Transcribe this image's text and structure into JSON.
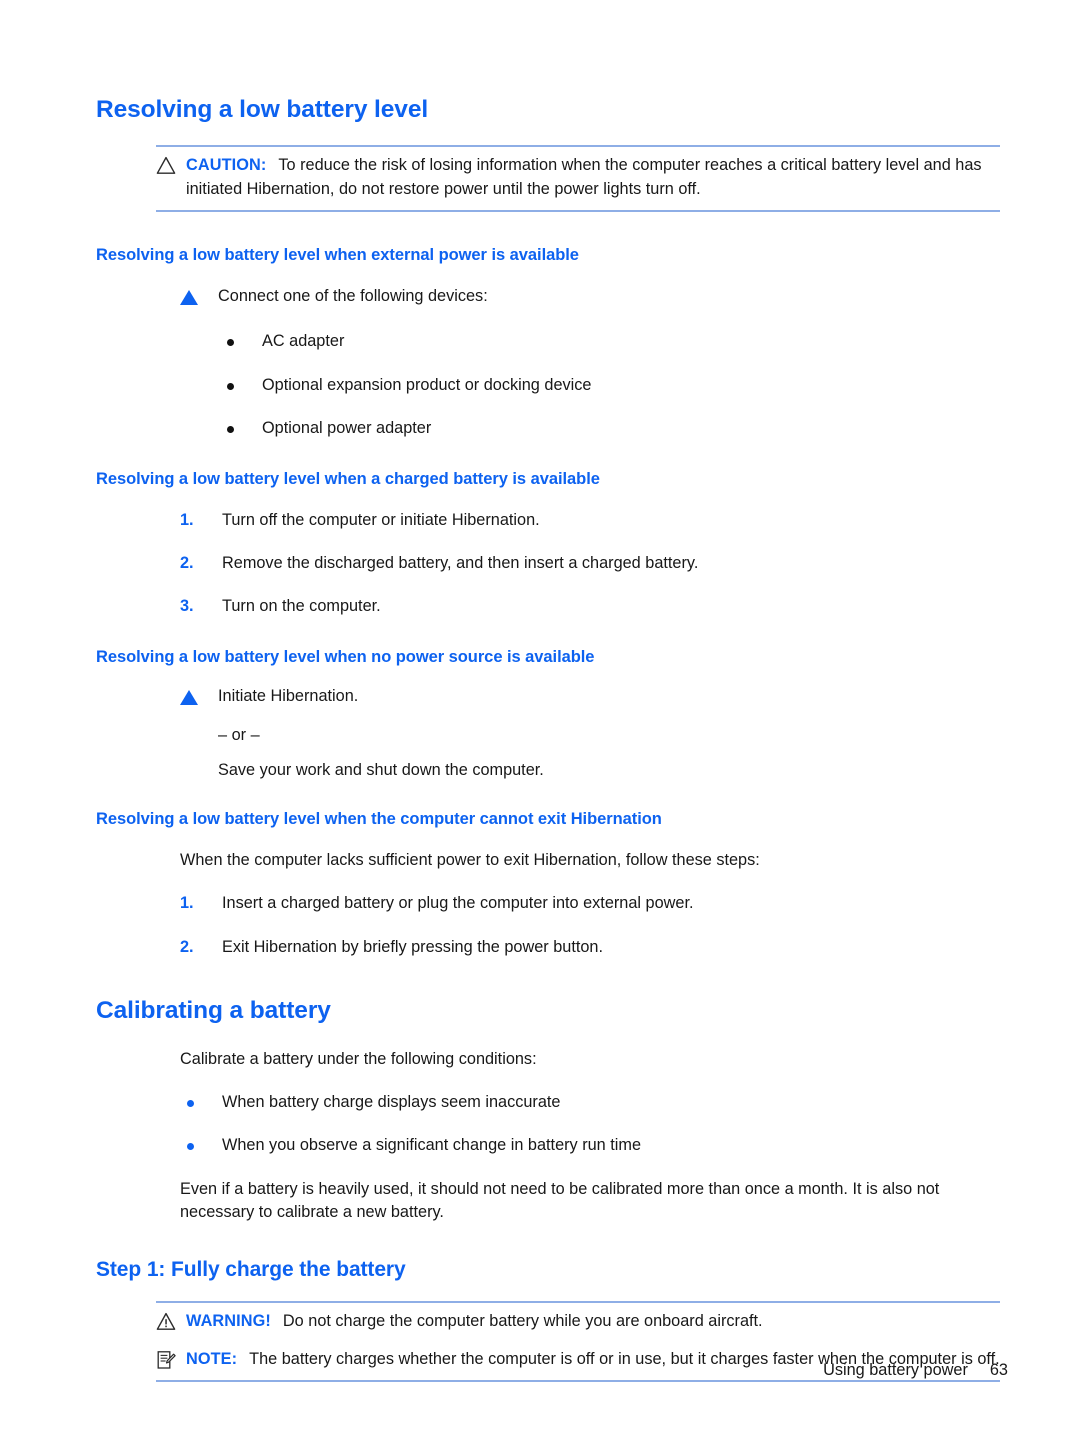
{
  "page": {
    "section_title": "Resolving a low battery level",
    "footer": {
      "running_head": "Using battery power",
      "page_number": "63"
    },
    "colors": {
      "heading_blue": "#0d62f0",
      "rule_blue": "#8eaee6",
      "body_black": "#181818",
      "bullet_black": "#111111"
    }
  },
  "caution": {
    "icon": "warning-triangle-icon",
    "label": "CAUTION:",
    "text": "To reduce the risk of losing information when the computer reaches a critical battery level and has initiated Hibernation, do not restore power until the power lights turn off."
  },
  "subsections": [
    {
      "heading": "Resolving a low battery level when external power is available",
      "lead": "Connect one of the following devices:",
      "bullets": [
        "AC adapter",
        "Optional expansion product or docking device",
        "Optional power adapter"
      ]
    },
    {
      "heading": "Resolving a low battery level when a charged battery is available",
      "steps": [
        {
          "num": "1.",
          "text": "Turn off the computer or initiate Hibernation."
        },
        {
          "num": "2.",
          "text": "Remove the discharged battery, and then insert a charged battery."
        },
        {
          "num": "3.",
          "text": "Turn on the computer."
        }
      ]
    },
    {
      "heading": "Resolving a low battery level when no power source is available",
      "lead": "Initiate Hibernation.",
      "or_separator": "– or –",
      "alternative": "Save your work and shut down the computer."
    },
    {
      "heading": "Resolving a low battery level when the computer cannot exit Hibernation",
      "lead": "When the computer lacks sufficient power to exit Hibernation, follow these steps:",
      "steps": [
        {
          "num": "1.",
          "text": "Insert a charged battery or plug the computer into external power."
        },
        {
          "num": "2.",
          "text": "Exit Hibernation by briefly pressing the power button."
        }
      ]
    }
  ],
  "calibrating": {
    "heading": "Calibrating a battery",
    "lead": "Calibrate a battery under the following conditions:",
    "bullets": [
      "When battery charge displays seem inaccurate",
      "When you observe a significant change in battery run time"
    ],
    "paragraph": "Even if a battery is heavily used, it should not need to be calibrated more than once a month. It is also not necessary to calibrate a new battery."
  },
  "step1": {
    "heading": "Step 1: Fully charge the battery",
    "warning": {
      "icon": "warning-triangle-exclamation-icon",
      "label": "WARNING!",
      "text": "Do not charge the computer battery while you are onboard aircraft."
    },
    "note": {
      "icon": "note-pencil-icon",
      "label": "NOTE:",
      "text": "The battery charges whether the computer is off or in use, but it charges faster when the computer is off."
    }
  }
}
